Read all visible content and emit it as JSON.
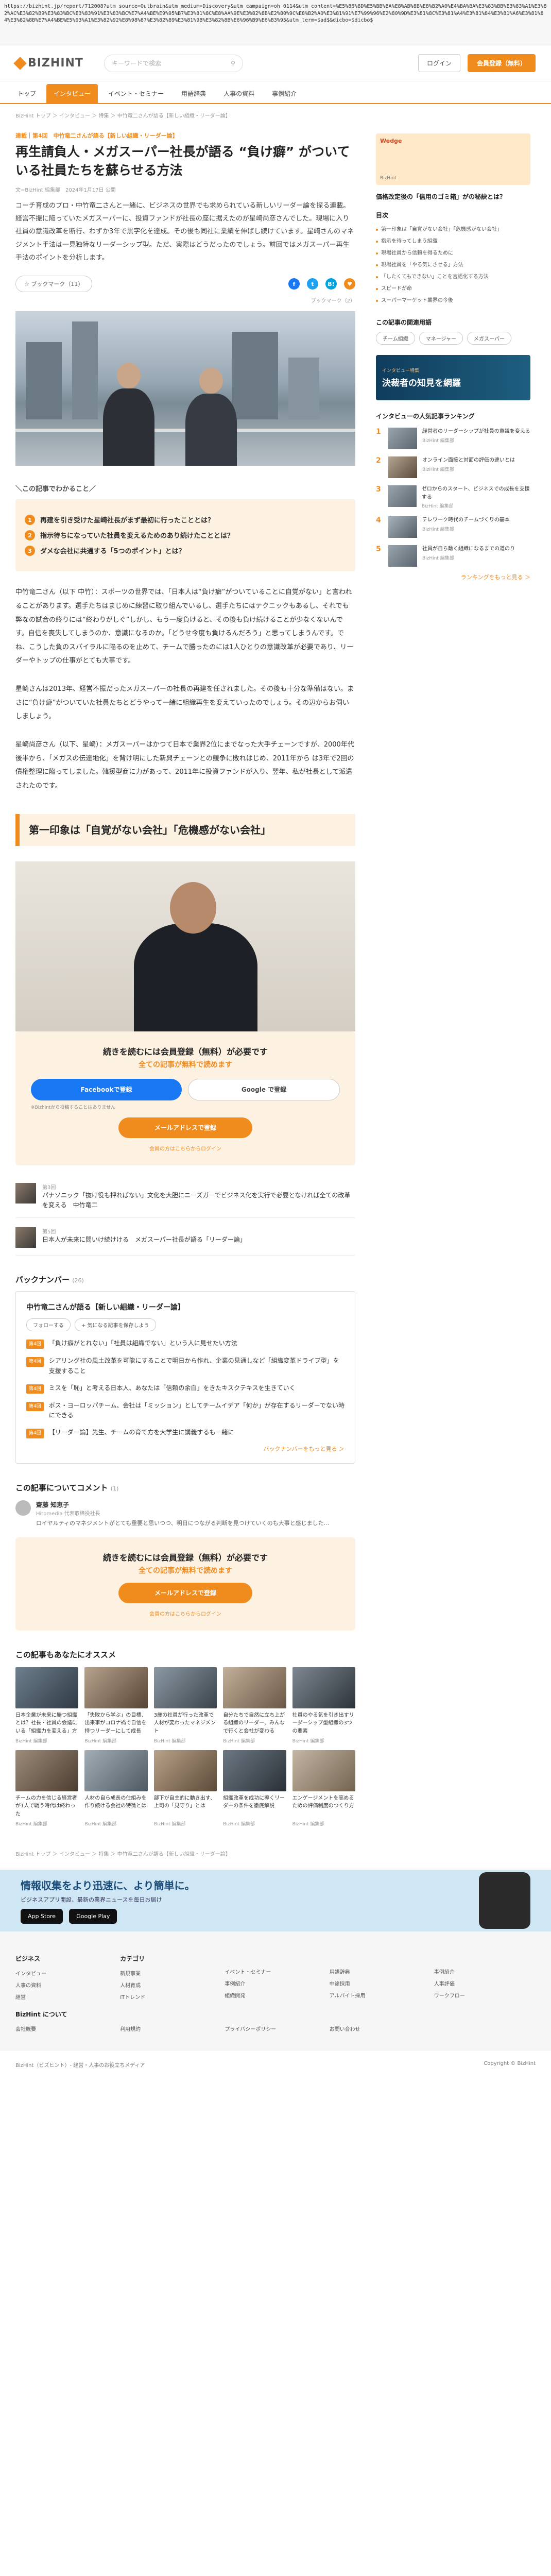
{
  "url": "https://bizhint.jp/report/712008?utm_source=Outbrain&utm_medium=Discovery&utm_campaign=oh_0114&utm_content=%E5%86%8D%E5%BB%BA%E8%AB%8B%E8%B2%A0%E4%BA%BA%E3%83%BB%E3%83%A1%E3%82%AC%E3%82%B9%E3%83%BC%E3%83%91%E3%83%BC%E7%A4%BE%E9%95%B7%E3%81%8C%E8%AA%9E%E3%82%8B%E2%80%9C%E8%B2%A0%E3%81%91%E7%99%96%E2%80%9D%E3%81%8C%E3%81%A4%E3%81%84%E3%81%A6%E3%81%84%E3%82%8B%E7%A4%BE%E5%93%A1%E3%82%92%E8%98%87%E3%82%89%E3%81%9B%E3%82%8B%E6%96%B9%E6%B3%95&utm_term=$ad$&dicbo=$dicbo$",
  "header": {
    "logo": "BIZHINT",
    "search_placeholder": "キーワードで検索",
    "login": "ログイン",
    "register": "会員登録（無料）"
  },
  "nav": [
    "トップ",
    "インタビュー",
    "イベント・セミナー",
    "用語辞典",
    "人事の資料",
    "事例紹介"
  ],
  "breadcrumb": "BizHint トップ ＞ インタビュー ＞ 特集 ＞ 中竹竜二さんが語る【新しい組織・リーダー論】",
  "article": {
    "series": "連載｜第4回　中竹竜二さんが語る【新しい組織・リーダー論】",
    "title": "再生請負人・メガスーパー社長が語る “負け癖” がついている社員たちを蘇らせる方法",
    "meta": "文=BizHint 編集部　2024年1月17日 公開",
    "lead": "コーチ育成のプロ・中竹竜二さんと一緒に、ビジネスの世界でも求められている新しいリーダー論を探る連載。経営不振に陥っていたメガスーパーに、投資ファンドが社長の座に据えたのが星崎尚彦さんでした。現場に入り社員の意識改革を断行、わずか3年で黒字化を達成。その後も同社に業績を伸ばし続けています。星崎さんのマネジメント手法は一見独特なリーダーシップ型。ただ、実際はどうだったのでしょう。前回ではメガスーパー再生手法のポイントを分析します。",
    "bookmark": "ブックマーク（11）",
    "share_count": "ブックマーク（2）",
    "summary_heading": "＼この記事でわかること／",
    "summary": [
      "再建を引き受けた星崎社長がまず最初に行ったこととは？",
      "指示待ちになっていた社員を変えるためのあり続けたこととは？",
      "ダメな会社に共通する「5つのポイント」とは？"
    ],
    "p1": "中竹竜二さん（以下 中竹）：スポーツの世界では、「日本人は“負け癖”がついていることに自覚がない」と言われることがあります。選手たちはまじめに練習に取り組んでいるし、選手たちにはテクニックもあるし、それでも弊なの試合の終りには“終わりがしぐ”しかし、もう一度負けると、その後も負け続けることが少なくないんです。自信を喪失してしまうのか、意識になるのか。「どうせ今度も負けるんだろう」と思ってしまうんです。でね、こうした負のスパイラルに陥るのを止めて、チームで勝ったのには1人ひとりの意識改革が必要であり、リーダーやトップの仕事がとても大事です。",
    "p2": "星崎さんは2013年、経営不振だったメガスーパーの社長の再建を任されました。その後も十分な準備はない。まさに“負け癖”がついていた社員たちとどうやって一緒に組織再生を変えていったのでしょう。その辺からお伺いしましょう。",
    "p3": "星崎尚彦さん（以下、星崎）：メガスーパーはかつて日本で業界2位にまでなった大手チェーンですが、2000年代後半から、「メガスの伝達地化」を背け明にした新興チェーンとの競争に敗れはじめ、2011年から は3年で2回の債権整理に陥ってしました。韓援型商に力があって、2011年に投資ファンドが入り、翌年、私が社長として派遣されたのです。",
    "h2": "第一印象は「自覚がない会社」「危機感がない会社」",
    "paywall_title": "続きを読むには会員登録（無料）が必要です",
    "paywall_sub": "全ての記事が無料で読めます",
    "fb_button": "Facebookで登録",
    "google_button": "Google で登録",
    "fb_note": "※Bizhintから投稿することはありません",
    "mail_button": "メールアドレスで登録",
    "login_link": "会員の方はこちらからログイン"
  },
  "related": [
    {
      "no": "第3回",
      "title": "パナソニック「抜け役も押ればない」文化を大胆にニーズガーでビジネス化を実行で必要となければ全ての改革を変える　中竹竜二"
    },
    {
      "no": "第5回",
      "title": "日本人が未来に問いけ続けける　メガスーパー社長が語る「リーダー論」"
    }
  ],
  "backnumber": {
    "heading": "バックナンバー",
    "count": "(26)",
    "title": "中竹竜二さんが語る【新しい組織・リーダー論】",
    "pills": [
      "フォローする",
      "+ 気になる記事を保存しよう"
    ],
    "badge": "第4回",
    "items": [
      "「負け癖がとれない」「社員は組織でない」という人に見せたい方法",
      "シアリング社の風土改革を可能にすることで明日から作れ、企業の見通しなど「組織変革ドライブ型」を支援すること",
      "ミスを「恥」と考える日本人、あなたは「信頼の余白」をきたキスクテキスを生きていく",
      "ボス・ヨーロッパチーム、会社は「ミッション」としてチームイデア「何か」が存在するリーダーでない時にできる",
      "【リーダー論】先生、チームの育て方を大学生に講義するも一緒に"
    ],
    "more": "バックナンバーをもっと見る ＞"
  },
  "comments": {
    "heading": "この記事についてコメント",
    "count": "(1)",
    "name": "齋藤 知恵子",
    "role": "Hitomedia 代表取締役社長",
    "text": "ロイヤルティのマネジメントがとても重要と思いつつ、明日につながる判断を見つけていくのも大事と感じました..."
  },
  "recommend": {
    "heading": "この記事もあなたにオススメ",
    "cards": [
      {
        "t": "日本企業が未来に勝つ組織とは？社長・社員の会議にいる「組織力を変える」方法",
        "s": "BizHint 編集部"
      },
      {
        "t": "「失敗から学ぶ」の目標、出来事がコロナ禍で自信を持つリーダーにして成長",
        "s": "BizHint 編集部"
      },
      {
        "t": "3歳の社員が行った改革で人材が変わったマネジメント",
        "s": "BizHint 編集部"
      },
      {
        "t": "自分たちで自然に立ち上がる組織のリーダー、みんなで行くと会社が変わる",
        "s": "BizHint 編集部"
      },
      {
        "t": "社員のやる気を引き出すリーダーシップ型組織の3つの要素",
        "s": "BizHint 編集部"
      },
      {
        "t": "チームの力を信じる経営者が1人で戦う時代は終わった",
        "s": "BizHint 編集部"
      },
      {
        "t": "人材の自ら成長の仕組みを作り続ける会社の特徴とは",
        "s": "BizHint 編集部"
      },
      {
        "t": "部下が自主的に動き出す、上司の「見守り」とは",
        "s": "BizHint 編集部"
      },
      {
        "t": "組織改革を成功に導くリーダーの条件を徹底解説",
        "s": "BizHint 編集部"
      },
      {
        "t": "エンゲージメントを高めるための評価制度のつくり方",
        "s": "BizHint 編集部"
      }
    ]
  },
  "sidebar": {
    "ad_brand": "Wedge",
    "ad_title": "価格改定後の「信用のゴミ箱」がの秘訣とは？",
    "ad_sub": "BizHint",
    "toc_title": "目次",
    "toc": [
      "第一印象は「自覚がない会社」「危機感がない会社」",
      "指示を待ってしまう組織",
      "現場社員から信頼を得るために",
      "現場社員を「やる気にさせる」方法",
      "「したくてもできない」ことを言語化する方法",
      "スピードが命",
      "スーパーマーケット業界の今後"
    ],
    "tags_title": "この記事の関連用語",
    "tags": [
      "チーム組織",
      "マネージャー",
      "メガスーパー"
    ],
    "banner_small": "インタビュー特集",
    "banner_main": "決裁者の知見を網羅",
    "rank_title": "インタビューの人気記事ランキング",
    "ranks": [
      {
        "t": "経営者のリーダーシップが社員の意識を変える",
        "s": "BizHint 編集部"
      },
      {
        "t": "オンライン面接と対面の評価の違いとは",
        "s": "BizHint 編集部"
      },
      {
        "t": "ゼロからのスタート、ビジネスでの成長を支援する",
        "s": "BizHint 編集部"
      },
      {
        "t": "テレワーク時代のチームづくりの基本",
        "s": "BizHint 編集部"
      },
      {
        "t": "社員が自ら動く組織になるまでの道のり",
        "s": "BizHint 編集部"
      }
    ],
    "rank_more": "ランキングをもっと見る ＞"
  },
  "bottom_breadcrumb": "BizHint トップ ＞ インタビュー ＞ 特集 ＞ 中竹竜二さんが語る【新しい組織・リーダー論】",
  "app": {
    "title": "情報収集をより迅速に、より簡単に。",
    "sub": "ビジネスアプリ開設、最新の業界ニュースを毎日お届け",
    "appstore": "App Store",
    "googleplay": "Google Play"
  },
  "footer": {
    "cols": [
      {
        "h": "ビジネス",
        "items": [
          "インタビュー",
          "人事の資料",
          "経営"
        ]
      },
      {
        "h": "カテゴリ",
        "items": [
          "新規事業",
          "人材育成",
          "ITトレンド"
        ]
      },
      {
        "h": "",
        "items": [
          "イベント・セミナー",
          "事例紹介",
          "組織開発"
        ]
      },
      {
        "h": "",
        "items": [
          "用語辞典",
          "中途採用",
          "アルバイト採用"
        ]
      },
      {
        "h": "",
        "items": [
          "事例紹介",
          "人事評価",
          "ワークフロー"
        ]
      }
    ],
    "about_h": "BizHint について",
    "about": [
      "会社概要",
      "利用規約",
      "プライバシーポリシー",
      "お問い合わせ"
    ],
    "copyright": "BizHint（ビズヒント）- 経営・人事のお役立ちメディア",
    "copyright2": "Copyright © BizHint"
  }
}
